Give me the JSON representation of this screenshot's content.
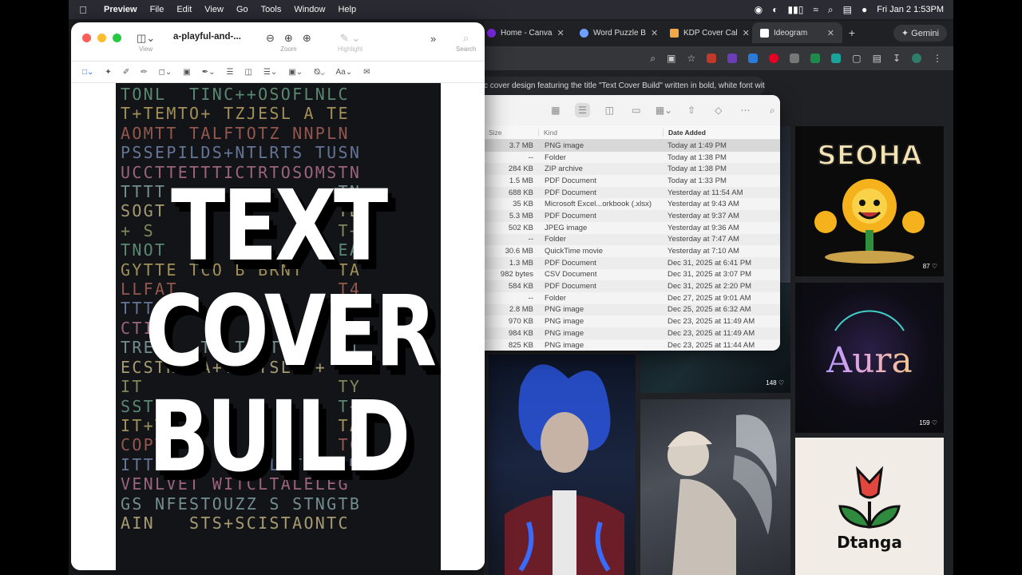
{
  "menubar": {
    "apple": "",
    "items": [
      "Preview",
      "File",
      "Edit",
      "View",
      "Go",
      "Tools",
      "Window",
      "Help"
    ],
    "datetime": "Fri Jan 2  1:53PM"
  },
  "browser": {
    "tabs": [
      {
        "label": "Home - Canva",
        "active": false
      },
      {
        "label": "Word Puzzle B",
        "active": false
      },
      {
        "label": "KDP Cover Cal",
        "active": false
      },
      {
        "label": "Ideogram",
        "active": true
      }
    ],
    "new_tab": "+",
    "gemini_label": "Gemini",
    "prompt_text": "c cover design featuring the title \"Text Cover Build\" written in bold, white font with",
    "tiles": {
      "seoha_text": "SEOHA",
      "seoha_likes": "87 ♡",
      "aura_text": "Aura",
      "aura_likes": "159 ♡",
      "dark_likes": "148 ♡",
      "dtanga_text": "Dtanga"
    }
  },
  "finder": {
    "columns": {
      "size": "Size",
      "kind": "Kind",
      "date": "Date Added"
    },
    "rows": [
      {
        "size": "3.7 MB",
        "kind": "PNG image",
        "date": "Today at 1:49 PM",
        "selected": true
      },
      {
        "size": "--",
        "kind": "Folder",
        "date": "Today at 1:38 PM"
      },
      {
        "size": "284 KB",
        "kind": "ZIP archive",
        "date": "Today at 1:38 PM"
      },
      {
        "size": "1.5 MB",
        "kind": "PDF Document",
        "date": "Today at 1:33 PM"
      },
      {
        "size": "688 KB",
        "kind": "PDF Document",
        "date": "Yesterday at 11:54 AM"
      },
      {
        "size": "35 KB",
        "kind": "Microsoft Excel...orkbook (.xlsx)",
        "date": "Yesterday at 9:43 AM"
      },
      {
        "size": "5.3 MB",
        "kind": "PDF Document",
        "date": "Yesterday at 9:37 AM"
      },
      {
        "size": "502 KB",
        "kind": "JPEG image",
        "date": "Yesterday at 9:36 AM"
      },
      {
        "size": "--",
        "kind": "Folder",
        "date": "Yesterday at 7:47 AM"
      },
      {
        "size": "30.6 MB",
        "kind": "QuickTime movie",
        "date": "Yesterday at 7:10 AM"
      },
      {
        "size": "1.3 MB",
        "kind": "PDF Document",
        "date": "Dec 31, 2025 at 6:41 PM"
      },
      {
        "size": "982 bytes",
        "kind": "CSV Document",
        "date": "Dec 31, 2025 at 3:07 PM"
      },
      {
        "size": "584 KB",
        "kind": "PDF Document",
        "date": "Dec 31, 2025 at 2:20 PM"
      },
      {
        "size": "--",
        "kind": "Folder",
        "date": "Dec 27, 2025 at 9:01 AM"
      },
      {
        "size": "2.8 MB",
        "kind": "PNG image",
        "date": "Dec 25, 2025 at 6:32 AM"
      },
      {
        "size": "970 KB",
        "kind": "PNG image",
        "date": "Dec 23, 2025 at 11:49 AM"
      },
      {
        "size": "984 KB",
        "kind": "PNG image",
        "date": "Dec 23, 2025 at 11:49 AM"
      },
      {
        "size": "825 KB",
        "kind": "PNG image",
        "date": "Dec 23, 2025 at 11:44 AM"
      }
    ]
  },
  "preview": {
    "doc_title": "a-playful-and-...",
    "view_label": "View",
    "zoom_label": "Zoom",
    "highlight_label": "Highlight",
    "search_label": "Search",
    "markup_font_label": "Aa",
    "cover": {
      "title_lines": [
        "TEXT",
        "COVER",
        "BUILD"
      ],
      "letter_rows": [
        "TONL  TINC++OSOFLNLC",
        "T+TEMTO+ TZJESL A TE",
        "AOMTT TALFTOTZ NNPLN",
        "PSSEPILDS+NTLRTS TUSN",
        "UCCTTETTTICTRTOSOMSTN",
        "TTTT               TN",
        "SOGT           N   TB",
        "+ S                T+",
        "TNOT               EA",
        "GYTTE TCO B BRNT   TA",
        "LLFAT              T4",
        "TTT                TS",
        "CTIT               TC",
        "TRE    T  TCET     TI",
        "ECSTNG A+TRTTSLRB+ &",
        "IT                 TY",
        "SST                T+",
        "IT+T               TA",
        "COPT               TC",
        "ITTSL CI VPSRLTT N  M",
        "VENLVET WITCLTALELEG",
        "GS NFESTOUZZ S STNGTB",
        "AIN   STS+SCISTAONTC"
      ]
    }
  },
  "colors": {
    "menubar": "#2a2b33",
    "cover_bg": "#121418",
    "accent": "#2a6cf0",
    "close": "#ff5f57",
    "minimize": "#febc2e",
    "zoom": "#28c840"
  }
}
